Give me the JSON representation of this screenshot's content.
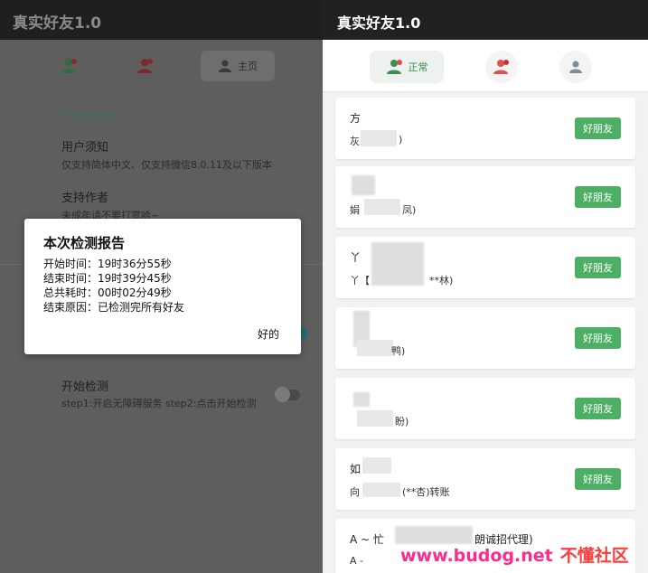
{
  "left": {
    "title": "真实好友1.0",
    "tabs": [
      {
        "label": ""
      },
      {
        "label": ""
      },
      {
        "label": "主页"
      }
    ],
    "section_title": "Messages",
    "items": [
      {
        "heading": "用户须知",
        "sub": "仅支持简体中文、仅支持微信8.0.11及以下版本"
      },
      {
        "heading": "支持作者",
        "sub": "未成年请不要打赏哈~"
      },
      {
        "heading": "开始检测",
        "sub": "step1:开启无障碍服务 step2:点击开始检测"
      }
    ],
    "dialog": {
      "title": "本次检测报告",
      "lines": [
        "开始时间：19时36分55秒",
        "结束时间：19时39分45秒",
        "总共耗时：00时02分49秒",
        "结束原因：已检测完所有好友"
      ],
      "ok": "好的"
    }
  },
  "right": {
    "title": "真实好友1.0",
    "tabs": [
      {
        "label": "正常"
      },
      {
        "label": ""
      },
      {
        "label": ""
      }
    ],
    "cards": [
      {
        "line1": "方",
        "line2": "灰",
        "line2_end": ")",
        "button": "好朋友"
      },
      {
        "line1": "",
        "line2": "娟",
        "line2_end": "凤)",
        "button": "好朋友"
      },
      {
        "line1": "丫",
        "line2": "丫【",
        "line2_end": "**林)",
        "button": "好朋友"
      },
      {
        "line1": "",
        "line2": "",
        "line2_end": "鸭)",
        "button": "好朋友"
      },
      {
        "line1": "",
        "line2": "",
        "line2_end": "盼)",
        "button": "好朋友"
      },
      {
        "line1": "如",
        "line2": "向",
        "line2_end": "(**杏)转账",
        "button": "好朋友"
      },
      {
        "line1": "A ~ 忙",
        "line1_end": "朗诚招代理)",
        "line2": "A -",
        "line2_end": "",
        "button": ""
      }
    ]
  },
  "watermark": {
    "site": "www.budog.net",
    "name": "不懂社区"
  },
  "colors": {
    "accent_green": "#4daf64",
    "appbar_dark": "#212121",
    "watermark": "#ff2b8a"
  }
}
